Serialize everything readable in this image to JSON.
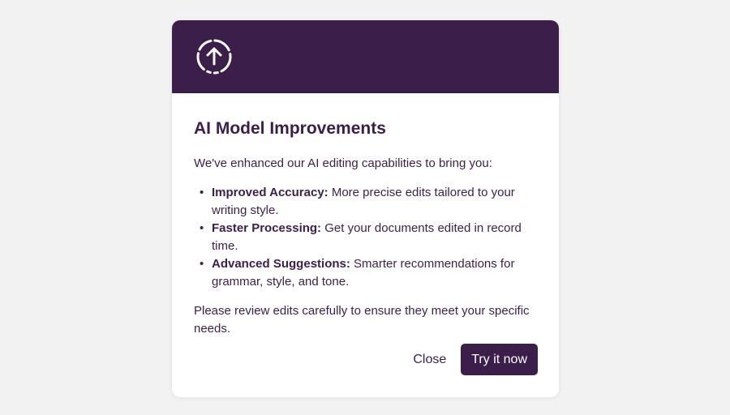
{
  "modal": {
    "header_icon": "upload-arrow-circle-icon",
    "title": "AI Model Improvements",
    "intro": "We've enhanced our AI editing capabilities to bring you:",
    "features": [
      {
        "label": "Improved Accuracy:",
        "text": " More precise edits tailored to your writing style."
      },
      {
        "label": "Faster Processing:",
        "text": " Get your documents edited in record time."
      },
      {
        "label": "Advanced Suggestions:",
        "text": " Smarter recommendations for grammar, style, and tone."
      }
    ],
    "bullet": "•",
    "note": "Please review edits carefully to ensure they meet your specific needs.",
    "close_label": "Close",
    "primary_label": "Try it now"
  },
  "colors": {
    "brand": "#3b1f4a",
    "background": "#f2f2f2",
    "surface": "#ffffff"
  }
}
